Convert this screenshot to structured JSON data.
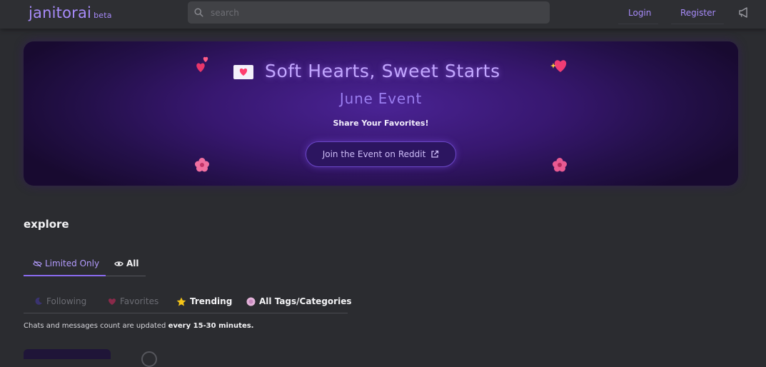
{
  "header": {
    "logo_text": "janitorai",
    "logo_badge": "beta",
    "search_placeholder": "search",
    "login_label": "Login",
    "register_label": "Register",
    "icons": [
      "search-icon",
      "megaphone-icon"
    ]
  },
  "banner": {
    "title": "Soft Hearts, Sweet Starts",
    "subtitle": "June Event",
    "tagline": "Share Your Favorites!",
    "button_label": "Join the Event on Reddit",
    "icons": [
      "love-letter-icon",
      "heart-icon",
      "flower-icon",
      "external-link-icon"
    ]
  },
  "explore": {
    "heading": "explore",
    "tabs": [
      {
        "label": "Limited Only",
        "icon": "eye-slash-icon",
        "active": true
      },
      {
        "label": "All",
        "icon": "eye-icon",
        "active": false
      }
    ],
    "filters": [
      {
        "label": "Following",
        "icon": "moon-icon",
        "enabled": false
      },
      {
        "label": "Favorites",
        "icon": "heart-icon",
        "enabled": false
      },
      {
        "label": "Trending",
        "icon": "star-icon",
        "enabled": true
      },
      {
        "label": "All Tags/Categories",
        "icon": "tag-circle-icon",
        "enabled": true
      }
    ],
    "note_prefix": "Chats and messages count are updated ",
    "note_bold": "every 15-30 minutes."
  },
  "colors": {
    "accent": "#a78bfa",
    "background": "#2b2c30",
    "banner_dark": "#180a30",
    "banner_mid": "#4a2394"
  }
}
